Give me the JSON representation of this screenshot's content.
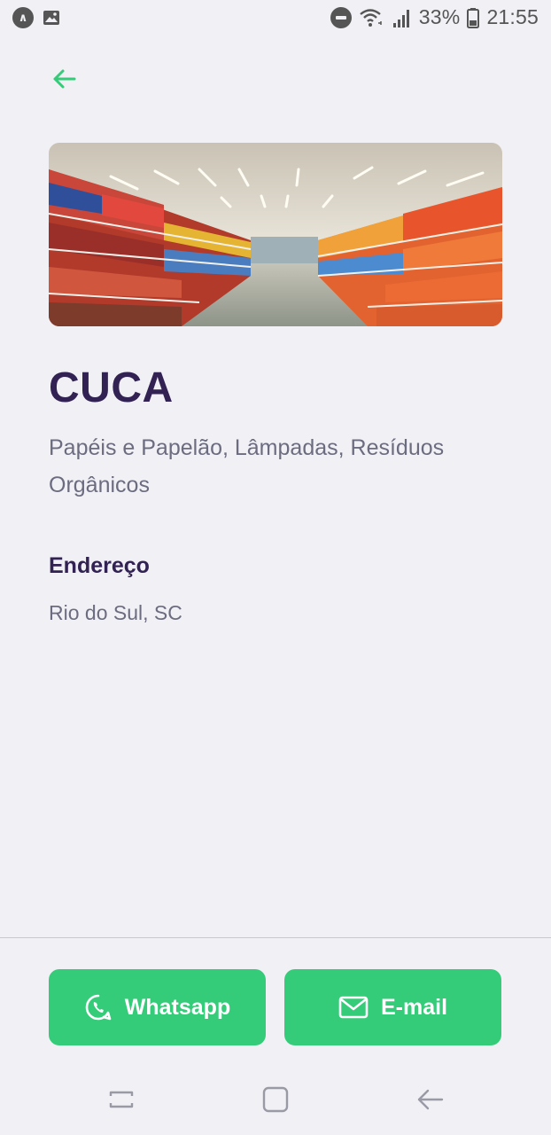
{
  "status_bar": {
    "battery": "33%",
    "time": "21:55",
    "icons": [
      "app-icon",
      "gallery-icon",
      "do-not-disturb-icon",
      "wifi-icon",
      "signal-icon",
      "battery-icon"
    ]
  },
  "header": {
    "back_icon": "arrow-left-icon"
  },
  "place": {
    "name": "CUCA",
    "categories": "Papéis e Papelão, Lâmpadas, Resíduos Orgânicos",
    "address_label": "Endereço",
    "address_value": "Rio do Sul, SC"
  },
  "actions": {
    "whatsapp_label": "Whatsapp",
    "email_label": "E-mail"
  },
  "colors": {
    "accent": "#34cb79",
    "title": "#322153",
    "text": "#6c6c80",
    "background": "#f0f0f5"
  },
  "nav": {
    "icons": [
      "recent-apps-icon",
      "home-icon",
      "back-icon"
    ]
  }
}
